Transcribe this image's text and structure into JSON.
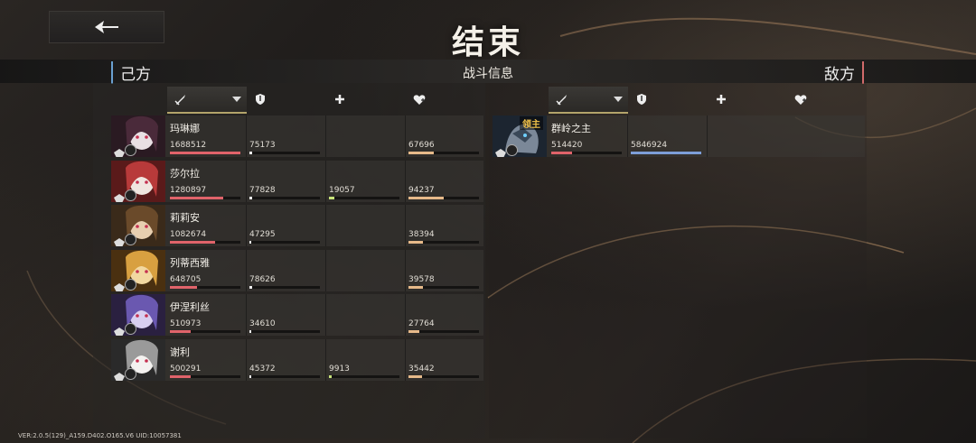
{
  "title": "结束",
  "header": {
    "ally_label": "己方",
    "center_label": "战斗信息",
    "enemy_label": "敌方"
  },
  "colors": {
    "damage": "#e0636a",
    "taken": "#f0f0f0",
    "heal": "#c8e37a",
    "shield": "#e6b989",
    "enemy_taken": "#7d9ed8"
  },
  "ally": {
    "columns": [
      "damage-dealt-icon",
      "damage-taken-icon",
      "healing-icon",
      "shield-icon"
    ],
    "units": [
      {
        "name": "玛琳娜",
        "damage": "1688512",
        "taken": "75173",
        "heal": "",
        "shield": "67696",
        "damage_pct": 1.0,
        "taken_pct": 0.04,
        "heal_pct": 0,
        "shield_pct": 0.36
      },
      {
        "name": "莎尔拉",
        "damage": "1280897",
        "taken": "77828",
        "heal": "19057",
        "shield": "94237",
        "damage_pct": 0.76,
        "taken_pct": 0.04,
        "heal_pct": 0.08,
        "shield_pct": 0.5
      },
      {
        "name": "莉莉安",
        "damage": "1082674",
        "taken": "47295",
        "heal": "",
        "shield": "38394",
        "damage_pct": 0.64,
        "taken_pct": 0.02,
        "heal_pct": 0,
        "shield_pct": 0.2
      },
      {
        "name": "列蒂西雅",
        "damage": "648705",
        "taken": "78626",
        "heal": "",
        "shield": "39578",
        "damage_pct": 0.38,
        "taken_pct": 0.04,
        "heal_pct": 0,
        "shield_pct": 0.21
      },
      {
        "name": "伊涅利丝",
        "damage": "510973",
        "taken": "34610",
        "heal": "",
        "shield": "27764",
        "damage_pct": 0.3,
        "taken_pct": 0.02,
        "heal_pct": 0,
        "shield_pct": 0.15
      },
      {
        "name": "谢利",
        "damage": "500291",
        "taken": "45372",
        "heal": "9913",
        "shield": "35442",
        "damage_pct": 0.3,
        "taken_pct": 0.02,
        "heal_pct": 0.04,
        "shield_pct": 0.19
      }
    ]
  },
  "enemy": {
    "columns": [
      "damage-dealt-icon",
      "damage-taken-icon",
      "healing-icon",
      "shield-icon"
    ],
    "units": [
      {
        "name": "群岭之主",
        "tag": "领主",
        "damage": "514420",
        "taken": "5846924",
        "damage_pct": 0.3,
        "taken_pct": 1.0
      }
    ]
  },
  "footer": {
    "version": "VER:2.0.5(129)_A159.D402.O165.V6   UID:10057381"
  }
}
